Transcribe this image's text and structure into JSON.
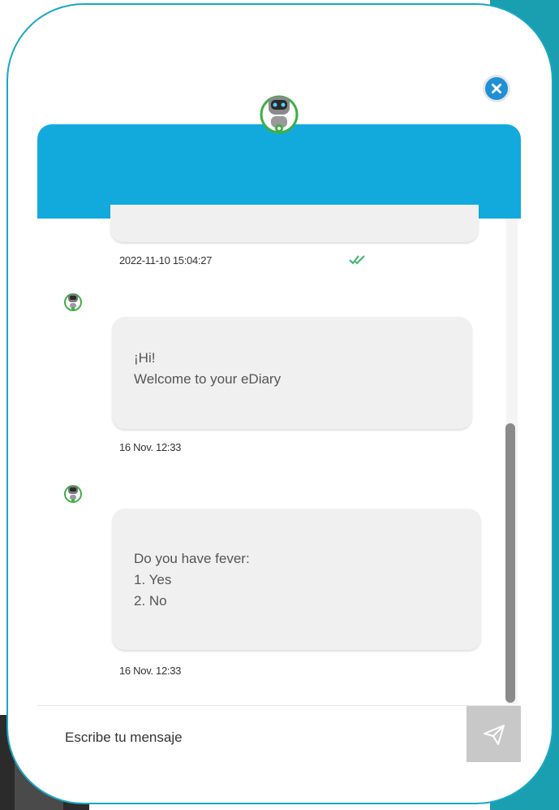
{
  "chat": {
    "messages": [
      {
        "lines": [
          "¡Hi!",
          "Welcome to your eDiary"
        ],
        "timestamp": "16 Nov. 12:33"
      },
      {
        "lines": [
          "Do you have fever:",
          "1. Yes",
          "2. No"
        ],
        "timestamp": "16 Nov. 12:33"
      }
    ],
    "previous_timestamp": "2022-11-10 15:04:27",
    "previous_status_icon": "double-check-icon"
  },
  "input": {
    "placeholder": "Escribe tu mensaje"
  },
  "icons": {
    "close": "close-icon",
    "send": "send-icon",
    "bot_avatar": "robot-avatar-icon"
  },
  "colors": {
    "header": "#12aadd",
    "card_border": "#1aa7c2",
    "close_button": "#1f8fd6",
    "bubble": "#f0f0f0",
    "send_button": "#c8c8c8",
    "check": "#3cb371"
  }
}
